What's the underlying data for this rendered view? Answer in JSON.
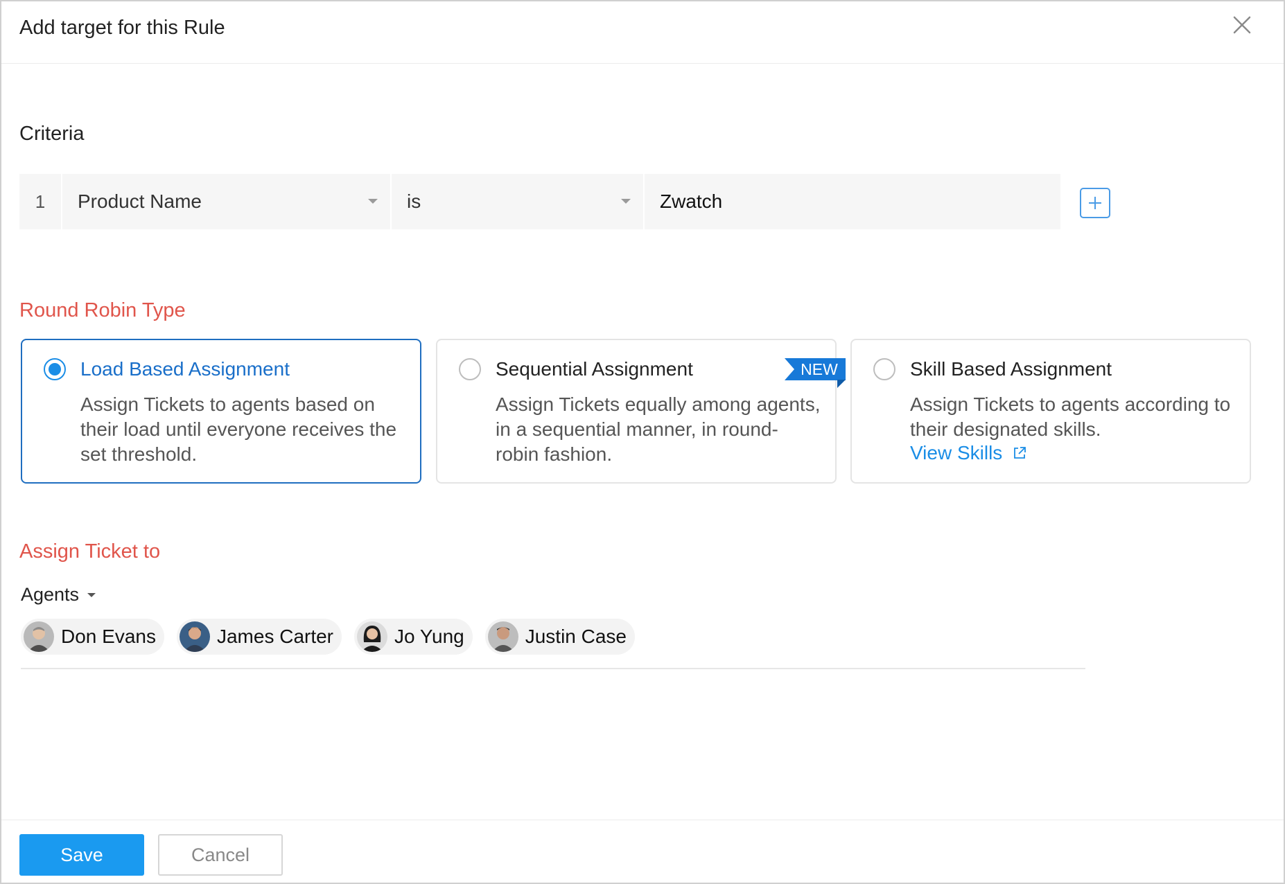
{
  "dialog": {
    "title": "Add target for this Rule",
    "close_icon": "close-icon"
  },
  "criteria": {
    "label": "Criteria",
    "rows": [
      {
        "index": "1",
        "field": "Product Name",
        "operator": "is",
        "value": "Zwatch"
      }
    ],
    "add_icon": "plus-icon"
  },
  "round_robin": {
    "label": "Round Robin Type",
    "selected": "Load Based Assignment",
    "options": [
      {
        "title": "Load Based Assignment",
        "description": "Assign Tickets to agents based on their load until everyone receives the set threshold."
      },
      {
        "title": "Sequential Assignment",
        "description": "Assign Tickets equally among agents, in a sequential manner, in round-robin fashion.",
        "badge": "NEW"
      },
      {
        "title": "Skill Based Assignment",
        "description": "Assign Tickets to agents according to their designated skills.",
        "link": "View Skills"
      }
    ]
  },
  "assign": {
    "label": "Assign Ticket to",
    "type_selected": "Agents",
    "agents": [
      {
        "name": "Don Evans"
      },
      {
        "name": "James Carter"
      },
      {
        "name": "Jo Yung"
      },
      {
        "name": "Justin Case"
      }
    ]
  },
  "footer": {
    "save_label": "Save",
    "cancel_label": "Cancel"
  },
  "colors": {
    "accent": "#1a8de6",
    "section_label": "#e0554b",
    "badge": "#1779d8",
    "save_button": "#1a9af0"
  }
}
